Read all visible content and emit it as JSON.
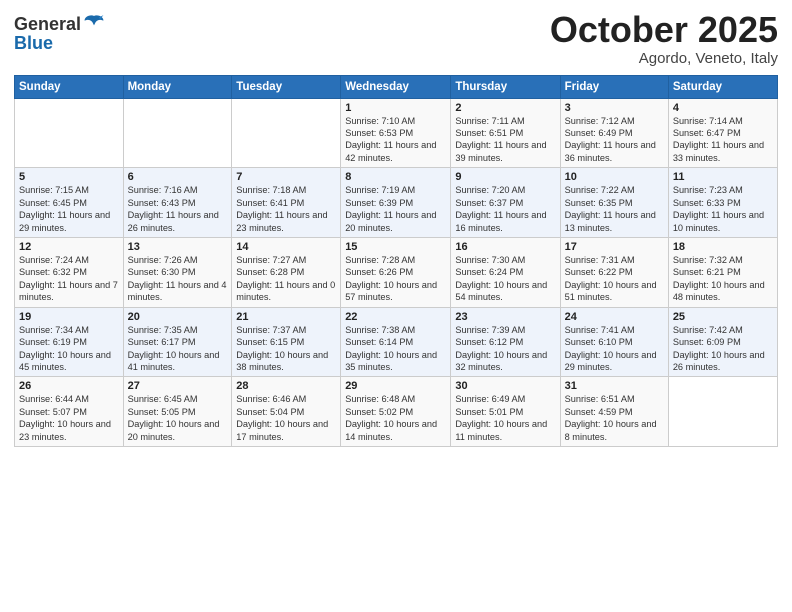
{
  "header": {
    "logo_general": "General",
    "logo_blue": "Blue",
    "month": "October 2025",
    "location": "Agordo, Veneto, Italy"
  },
  "weekdays": [
    "Sunday",
    "Monday",
    "Tuesday",
    "Wednesday",
    "Thursday",
    "Friday",
    "Saturday"
  ],
  "weeks": [
    [
      {
        "day": "",
        "info": ""
      },
      {
        "day": "",
        "info": ""
      },
      {
        "day": "",
        "info": ""
      },
      {
        "day": "1",
        "info": "Sunrise: 7:10 AM\nSunset: 6:53 PM\nDaylight: 11 hours and 42 minutes."
      },
      {
        "day": "2",
        "info": "Sunrise: 7:11 AM\nSunset: 6:51 PM\nDaylight: 11 hours and 39 minutes."
      },
      {
        "day": "3",
        "info": "Sunrise: 7:12 AM\nSunset: 6:49 PM\nDaylight: 11 hours and 36 minutes."
      },
      {
        "day": "4",
        "info": "Sunrise: 7:14 AM\nSunset: 6:47 PM\nDaylight: 11 hours and 33 minutes."
      }
    ],
    [
      {
        "day": "5",
        "info": "Sunrise: 7:15 AM\nSunset: 6:45 PM\nDaylight: 11 hours and 29 minutes."
      },
      {
        "day": "6",
        "info": "Sunrise: 7:16 AM\nSunset: 6:43 PM\nDaylight: 11 hours and 26 minutes."
      },
      {
        "day": "7",
        "info": "Sunrise: 7:18 AM\nSunset: 6:41 PM\nDaylight: 11 hours and 23 minutes."
      },
      {
        "day": "8",
        "info": "Sunrise: 7:19 AM\nSunset: 6:39 PM\nDaylight: 11 hours and 20 minutes."
      },
      {
        "day": "9",
        "info": "Sunrise: 7:20 AM\nSunset: 6:37 PM\nDaylight: 11 hours and 16 minutes."
      },
      {
        "day": "10",
        "info": "Sunrise: 7:22 AM\nSunset: 6:35 PM\nDaylight: 11 hours and 13 minutes."
      },
      {
        "day": "11",
        "info": "Sunrise: 7:23 AM\nSunset: 6:33 PM\nDaylight: 11 hours and 10 minutes."
      }
    ],
    [
      {
        "day": "12",
        "info": "Sunrise: 7:24 AM\nSunset: 6:32 PM\nDaylight: 11 hours and 7 minutes."
      },
      {
        "day": "13",
        "info": "Sunrise: 7:26 AM\nSunset: 6:30 PM\nDaylight: 11 hours and 4 minutes."
      },
      {
        "day": "14",
        "info": "Sunrise: 7:27 AM\nSunset: 6:28 PM\nDaylight: 11 hours and 0 minutes."
      },
      {
        "day": "15",
        "info": "Sunrise: 7:28 AM\nSunset: 6:26 PM\nDaylight: 10 hours and 57 minutes."
      },
      {
        "day": "16",
        "info": "Sunrise: 7:30 AM\nSunset: 6:24 PM\nDaylight: 10 hours and 54 minutes."
      },
      {
        "day": "17",
        "info": "Sunrise: 7:31 AM\nSunset: 6:22 PM\nDaylight: 10 hours and 51 minutes."
      },
      {
        "day": "18",
        "info": "Sunrise: 7:32 AM\nSunset: 6:21 PM\nDaylight: 10 hours and 48 minutes."
      }
    ],
    [
      {
        "day": "19",
        "info": "Sunrise: 7:34 AM\nSunset: 6:19 PM\nDaylight: 10 hours and 45 minutes."
      },
      {
        "day": "20",
        "info": "Sunrise: 7:35 AM\nSunset: 6:17 PM\nDaylight: 10 hours and 41 minutes."
      },
      {
        "day": "21",
        "info": "Sunrise: 7:37 AM\nSunset: 6:15 PM\nDaylight: 10 hours and 38 minutes."
      },
      {
        "day": "22",
        "info": "Sunrise: 7:38 AM\nSunset: 6:14 PM\nDaylight: 10 hours and 35 minutes."
      },
      {
        "day": "23",
        "info": "Sunrise: 7:39 AM\nSunset: 6:12 PM\nDaylight: 10 hours and 32 minutes."
      },
      {
        "day": "24",
        "info": "Sunrise: 7:41 AM\nSunset: 6:10 PM\nDaylight: 10 hours and 29 minutes."
      },
      {
        "day": "25",
        "info": "Sunrise: 7:42 AM\nSunset: 6:09 PM\nDaylight: 10 hours and 26 minutes."
      }
    ],
    [
      {
        "day": "26",
        "info": "Sunrise: 6:44 AM\nSunset: 5:07 PM\nDaylight: 10 hours and 23 minutes."
      },
      {
        "day": "27",
        "info": "Sunrise: 6:45 AM\nSunset: 5:05 PM\nDaylight: 10 hours and 20 minutes."
      },
      {
        "day": "28",
        "info": "Sunrise: 6:46 AM\nSunset: 5:04 PM\nDaylight: 10 hours and 17 minutes."
      },
      {
        "day": "29",
        "info": "Sunrise: 6:48 AM\nSunset: 5:02 PM\nDaylight: 10 hours and 14 minutes."
      },
      {
        "day": "30",
        "info": "Sunrise: 6:49 AM\nSunset: 5:01 PM\nDaylight: 10 hours and 11 minutes."
      },
      {
        "day": "31",
        "info": "Sunrise: 6:51 AM\nSunset: 4:59 PM\nDaylight: 10 hours and 8 minutes."
      },
      {
        "day": "",
        "info": ""
      }
    ]
  ]
}
